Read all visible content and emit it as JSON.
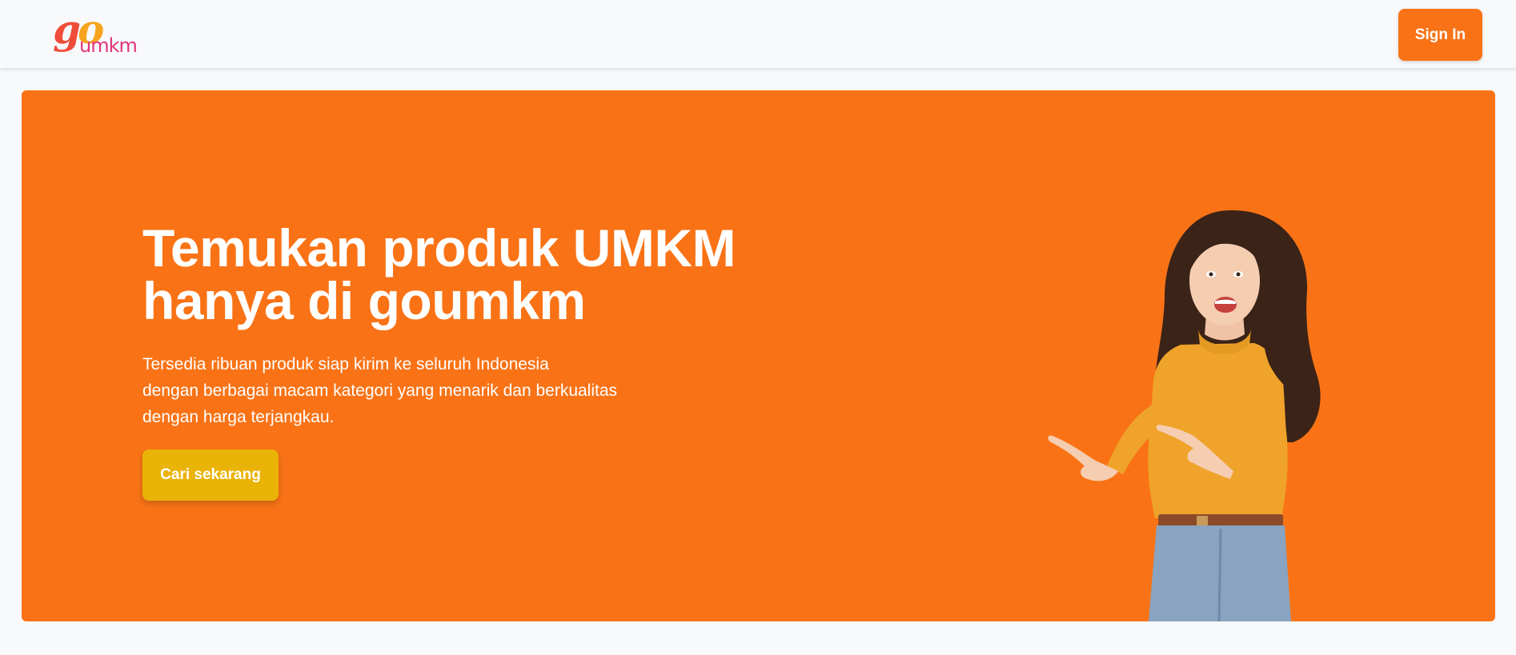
{
  "header": {
    "logo": {
      "text_go": "go",
      "text_umkm": "umkm"
    },
    "sign_in_label": "Sign In"
  },
  "hero": {
    "title_line1": "Temukan produk UMKM",
    "title_line2": "hanya di goumkm",
    "description_lines": [
      "Tersedia ribuan produk siap kirim ke seluruh Indonesia",
      "dengan berbagai macam kategori yang menarik dan berkualitas",
      "dengan harga terjangkau."
    ],
    "cta_label": "Cari sekarang",
    "image_alt": "woman pointing"
  },
  "colors": {
    "page_background": "#f8f9fb",
    "brand_orange": "#f97316",
    "cta_yellow": "#eab308",
    "logo_red": "#ef4d3a",
    "logo_yellow": "#f6a41f",
    "logo_pink": "#e0357c",
    "text_white": "#ffffff"
  }
}
